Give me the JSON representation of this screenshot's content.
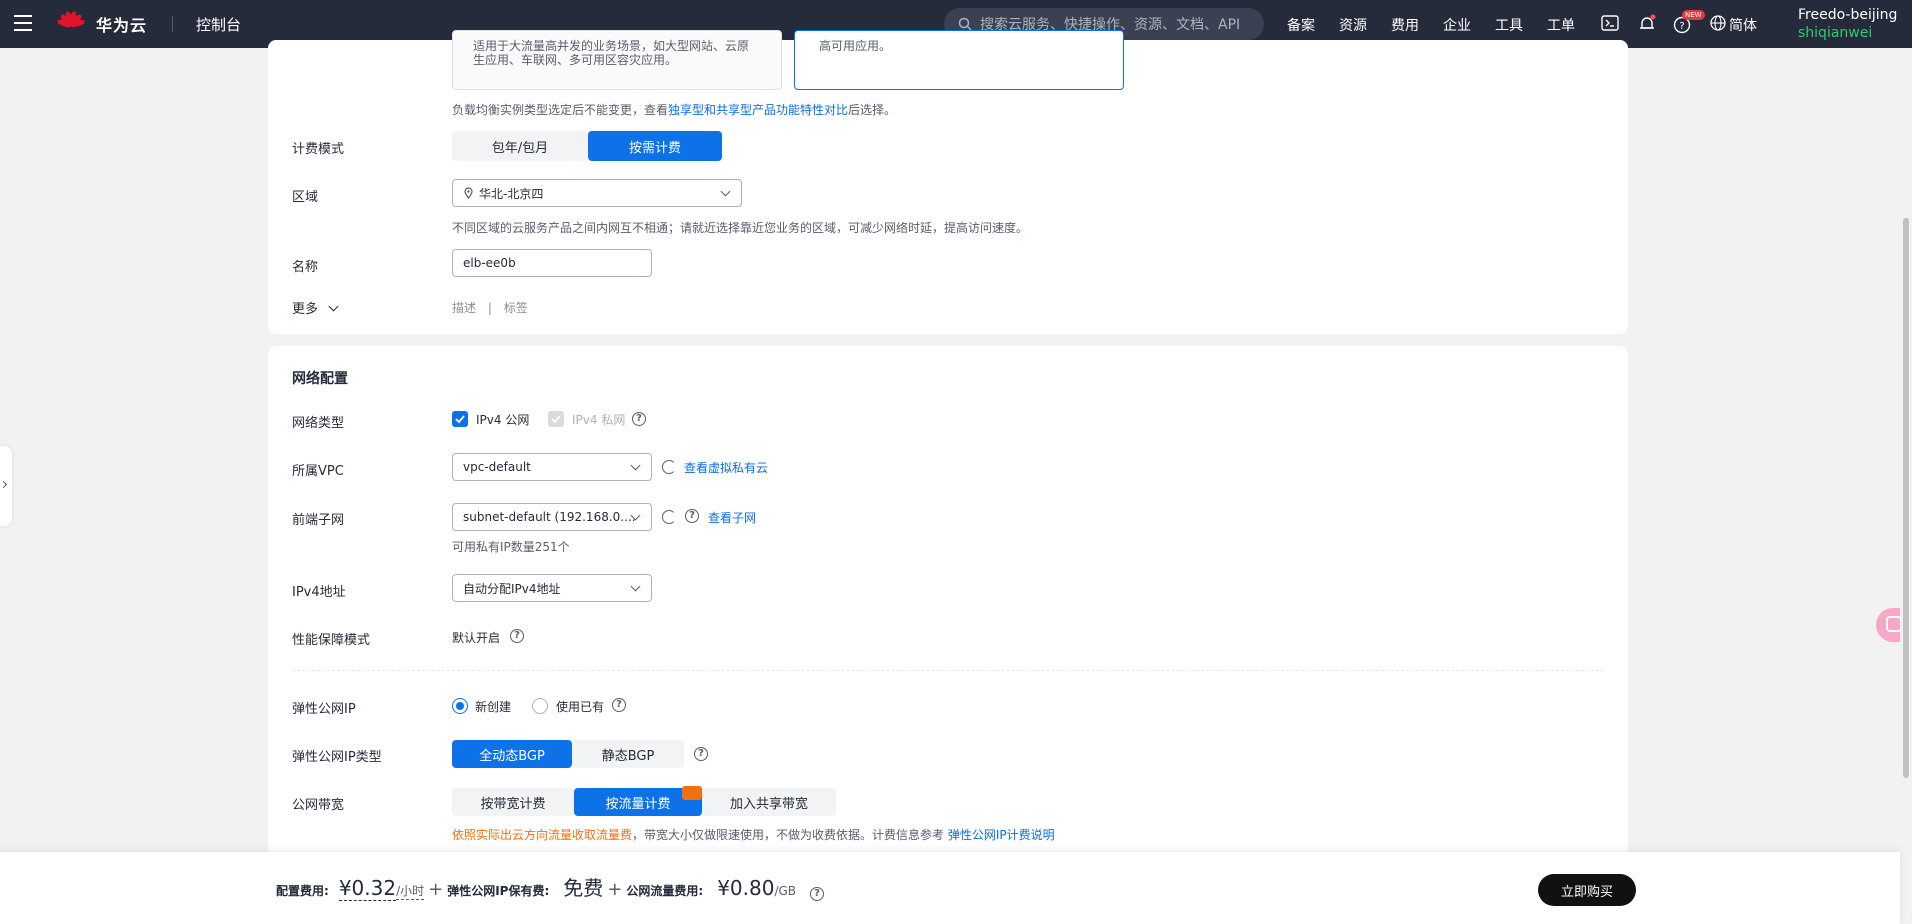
{
  "topbar": {
    "brand": "华为云",
    "console": "控制台",
    "search_placeholder": "搜索云服务、快捷操作、资源、文档、API",
    "nav": [
      "备案",
      "资源",
      "费用",
      "企业",
      "工具",
      "工单"
    ],
    "lang": "简体",
    "new_badge": "NEW",
    "user_line1": "Freedo-beijing",
    "user_line2": "shiqianwei"
  },
  "basic": {
    "type_card_desc1": "适用于大流量高并发的业务场景，如大型网站、云原",
    "type_card_desc2": "生应用、车联网、多可用区容灾应用。",
    "type_card_right": "高可用应用。",
    "type_hint_prefix": "负载均衡实例类型选定后不能变更，查看",
    "type_hint_link": "独享型和共享型产品功能特性对比",
    "type_hint_suffix": "后选择。",
    "billing_label": "计费模式",
    "billing_opts": [
      "包年/包月",
      "按需计费"
    ],
    "region_label": "区域",
    "region_value": "华北-北京四",
    "region_hint": "不同区域的云服务产品之间内网互不相通；请就近选择靠近您业务的区域，可减少网络时延，提高访问速度。",
    "name_label": "名称",
    "name_value": "elb-ee0b",
    "more_label": "更多",
    "more_desc": "描述",
    "more_tag": "标签"
  },
  "network": {
    "title": "网络配置",
    "nettype_label": "网络类型",
    "ipv4_public": "IPv4 公网",
    "ipv4_private": "IPv4 私网",
    "vpc_label": "所属VPC",
    "vpc_value": "vpc-default",
    "vpc_link": "查看虚拟私有云",
    "subnet_label": "前端子网",
    "subnet_value": "subnet-default (192.168.0....",
    "subnet_link": "查看子网",
    "subnet_hint": "可用私有IP数量251个",
    "ipv4_label": "IPv4地址",
    "ipv4_value": "自动分配IPv4地址",
    "perf_label": "性能保障模式",
    "perf_value": "默认开启",
    "eip_label": "弹性公网IP",
    "eip_new": "新创建",
    "eip_existing": "使用已有",
    "eiptype_label": "弹性公网IP类型",
    "eiptype_opts": [
      "全动态BGP",
      "静态BGP"
    ],
    "bw_label": "公网带宽",
    "bw_opts": [
      "按带宽计费",
      "按流量计费",
      "加入共享带宽"
    ],
    "bw_hint_orange": "依照实际出云方向流量收取流量费",
    "bw_hint_mid": "，带宽大小仅做限速使用，不做为收费依据。计费信息参考",
    "bw_hint_link": "弹性公网IP计费说明"
  },
  "footer": {
    "config_label": "配置费用:",
    "config_price": "¥0.32",
    "config_unit": "/小时",
    "eip_label": "弹性公网IP保有费:",
    "eip_value": "免费",
    "traffic_label": "公网流量费用:",
    "traffic_price": "¥0.80",
    "traffic_unit": "/GB",
    "buy": "立即购买"
  },
  "colors": {
    "primary": "#0d72e8",
    "topbar": "#252b3a",
    "warning": "#f66f0f"
  }
}
